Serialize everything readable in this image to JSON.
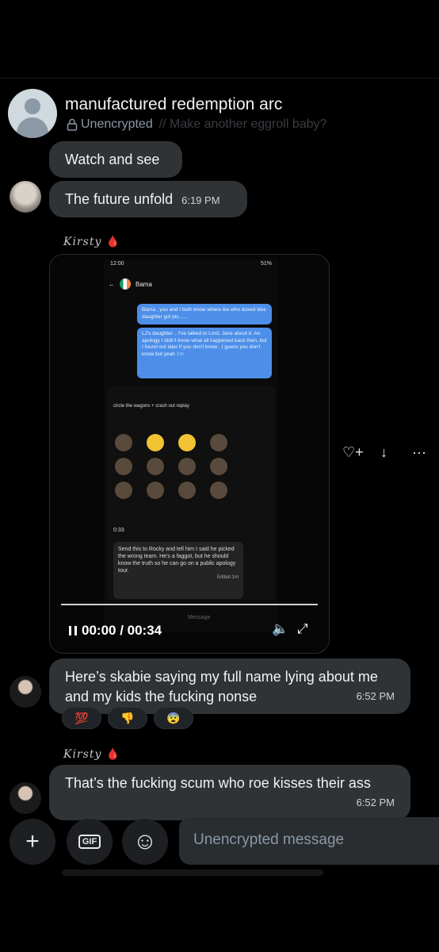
{
  "header": {
    "name": "manufactured redemption arc",
    "status": "Unencrypted",
    "ghost_text": "// Make another eggroll baby?"
  },
  "messages": [
    {
      "text": "Watch and see"
    },
    {
      "text": "The future unfold",
      "time": "6:19 PM"
    },
    {
      "text": "Here’s skabie saying my full name lying about me and my kids the fucking nonse",
      "time": "6:52 PM"
    },
    {
      "text": "That’s the fucking scum who roe kisses their ass",
      "time": "6:52 PM"
    }
  ],
  "senders": [
    {
      "name": "Kirsty",
      "emoji": "🩸"
    },
    {
      "name": "Kirsty",
      "emoji": "🩸"
    }
  ],
  "video": {
    "time_display": "00:00 / 00:34",
    "phone_status_time": "12:00",
    "phone_status_battery": "51%",
    "phone_contact": "Bama",
    "phone_msg_1": "Bama , you and I both know where ike who doxed ikke daughter got pic......",
    "phone_msg_2": "LJ's daughter .. I've talked to Lord, Jane about it. An apology I didn't know what all happened back then, but I found out later.If you don't know , I guess you don't know but yeah",
    "phone_msg_2_time": "1m",
    "space_title": "circle the wagons + crash out replay",
    "space_reply": "Send this to Rocky and tell him I said he picked the wrong team. He's a faggot, but he should know the truth so he can go on a public apology tour.",
    "space_reply_edited": "Edited 1m",
    "space_input_placeholder": "Message",
    "space_timer": "0:33"
  },
  "media_actions": {
    "react": "♡+",
    "download": "↓",
    "more": "···"
  },
  "reactions": [
    {
      "icon": "💯"
    },
    {
      "icon": "👎"
    },
    {
      "icon": "😨"
    }
  ],
  "composer": {
    "add": "+",
    "gif": "GIF",
    "emoji": "☺",
    "placeholder": "Unencrypted message"
  }
}
